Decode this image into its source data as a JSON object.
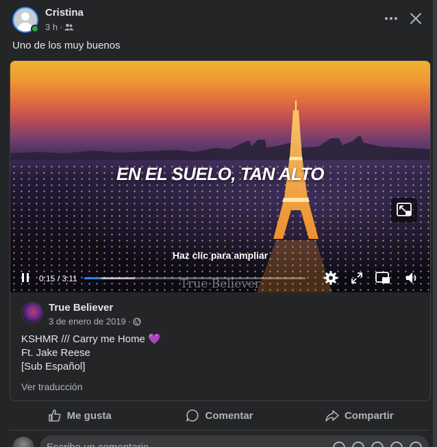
{
  "post": {
    "author": "Cristina",
    "time": "3 h",
    "separator": "·",
    "caption": "Uno de los muy buenos"
  },
  "video": {
    "title": "EN EL SUELO, TAN ALTO",
    "expand_hint": "Haz clic para ampliar",
    "watermark": "True Believer",
    "time_display": "0:15 / 3:11",
    "played_fraction": 0.078,
    "buffered_fraction": 0.23
  },
  "source": {
    "name": "True Believer",
    "date": "3 de enero de 2019",
    "separator": "·",
    "lines": [
      "KSHMR /// Carry me Home",
      "Ft. Jake Reese",
      "[Sub Español]"
    ],
    "heart": "💜",
    "see_translation": "Ver traducción"
  },
  "actions": {
    "like": "Me gusta",
    "comment": "Comentar",
    "share": "Compartir"
  },
  "comment_box": {
    "placeholder": "Escribe un comentario..."
  }
}
